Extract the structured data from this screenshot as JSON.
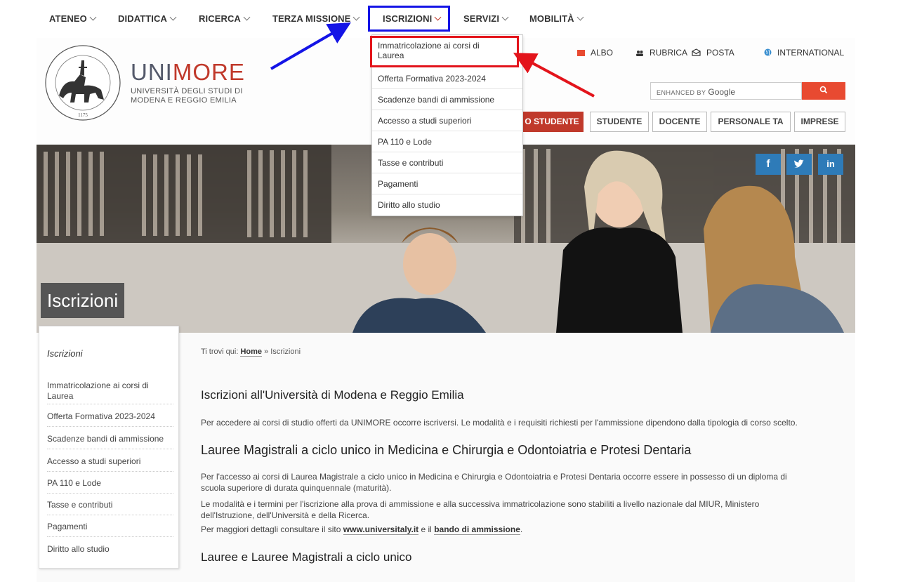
{
  "nav": {
    "items": [
      {
        "label": "ATENEO"
      },
      {
        "label": "DIDATTICA"
      },
      {
        "label": "RICERCA"
      },
      {
        "label": "TERZA MISSIONE"
      },
      {
        "label": "ISCRIZIONI"
      },
      {
        "label": "SERVIZI"
      },
      {
        "label": "MOBILITÀ"
      }
    ]
  },
  "brand": {
    "logo_a": "UNI",
    "logo_b": "MORE",
    "sub1": "UNIVERSITÀ DEGLI STUDI DI",
    "sub2": "MODENA E REGGIO EMILIA",
    "seal_year": "1175"
  },
  "utility": {
    "albo": "ALBO",
    "rubrica": "RUBRICA",
    "posta": "POSTA",
    "international": "INTERNATIONAL"
  },
  "search": {
    "enhanced_by": "ENHANCED BY",
    "google": "Google",
    "icon": "search-icon"
  },
  "roles": {
    "futuro": "O STUDENTE",
    "studente": "STUDENTE",
    "docente": "DOCENTE",
    "personale": "PERSONALE TA",
    "imprese": "IMPRESE"
  },
  "dropdown": {
    "items": [
      {
        "label1": "Immatricolazione ai corsi di",
        "label2": "Laurea"
      },
      {
        "label1": "Offerta Formativa 2023-2024"
      },
      {
        "label1": "Scadenze bandi di ammissione"
      },
      {
        "label1": "Accesso a studi superiori"
      },
      {
        "label1": "PA 110 e Lode"
      },
      {
        "label1": "Tasse e contributi"
      },
      {
        "label1": "Pagamenti"
      },
      {
        "label1": "Diritto allo studio"
      }
    ]
  },
  "social": {
    "facebook": "f",
    "twitter": "t",
    "linkedin": "in"
  },
  "hero": {
    "title": "Iscrizioni"
  },
  "sidebar": {
    "title": "Iscrizioni",
    "items": [
      {
        "label1": "Immatricolazione ai corsi di",
        "label2": "Laurea"
      },
      {
        "label1": "Offerta Formativa 2023-2024"
      },
      {
        "label1": "Scadenze bandi di ammissione"
      },
      {
        "label1": "Accesso a studi superiori"
      },
      {
        "label1": "PA 110 e Lode"
      },
      {
        "label1": "Tasse e contributi"
      },
      {
        "label1": "Pagamenti"
      },
      {
        "label1": "Diritto allo studio"
      }
    ]
  },
  "breadcrumb": {
    "prefix": "Ti trovi qui:",
    "home": "Home",
    "sep": "»",
    "current": "Iscrizioni"
  },
  "content": {
    "h1": "Iscrizioni all'Università di Modena e Reggio Emilia",
    "p1": "Per accedere ai corsi di studio offerti da UNIMORE occorre iscriversi. Le modalità e i requisiti richiesti per l'ammissione dipendono dalla tipologia di corso scelto.",
    "h2": "Lauree Magistrali a ciclo unico in Medicina e Chirurgia e Odontoiatria e Protesi Dentaria",
    "p2a": "Per l'accesso ai corsi di Laurea Magistrale a ciclo unico in Medicina e Chirurgia e Odontoiatria e Protesi Dentaria occorre essere in possesso di un diploma di",
    "p2b": "scuola superiore di durata quinquennale (maturità).",
    "p2c": "Le modalità e i termini per l'iscrizione alla prova di ammissione e alla successiva immatricolazione sono stabiliti a livello nazionale dal MIUR, Ministero",
    "p2d": "dell'Istruzione, dell'Università e della Ricerca.",
    "p2e_pre": "Per maggiori dettagli consultare il sito",
    "p2e_link1": "www.universitaly.it",
    "p2e_mid": "e il",
    "p2e_link2": "bando di ammissione",
    "p2e_end": ".",
    "h3": "Lauree e Lauree Magistrali a ciclo unico"
  },
  "colors": {
    "accent_red": "#c0392b",
    "highlight_blue": "#1414e6",
    "highlight_red": "#e3141b",
    "social_blue": "#2e7bb8"
  }
}
